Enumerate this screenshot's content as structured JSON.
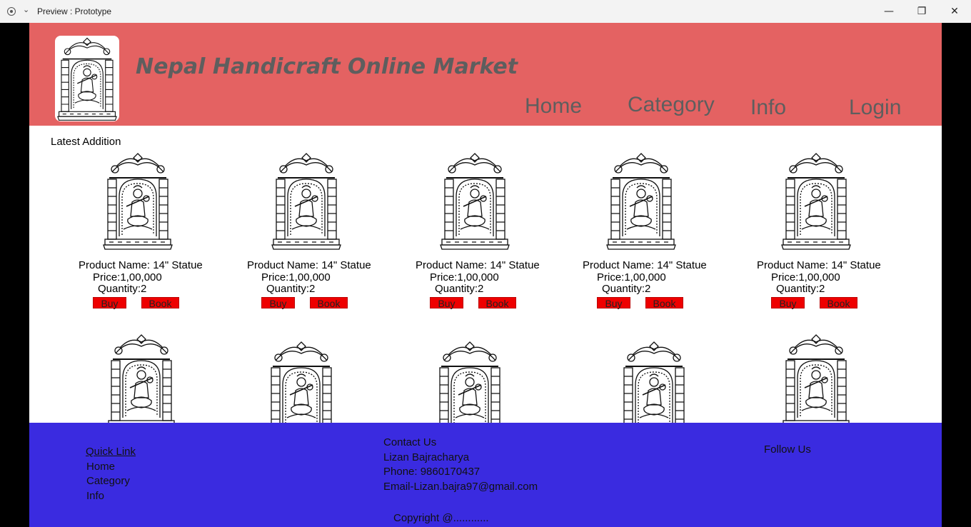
{
  "window": {
    "title": "Preview : Prototype",
    "menu_glyph": "⌄",
    "minimize_glyph": "—",
    "maximize_glyph": "❐",
    "close_glyph": "✕"
  },
  "header": {
    "title": "Nepal Handicraft Online Market",
    "nav": [
      "Home",
      "Category",
      "Info",
      "Login"
    ],
    "logo_icon": "saraswati-statue-icon"
  },
  "main": {
    "section_title": "Latest Addition",
    "products": [
      {
        "name": "Product Name: 14\" Statue",
        "price": "Price:1,00,000",
        "quantity": "Quantity:2",
        "buy": "Buy",
        "book": "Book"
      },
      {
        "name": "Product Name: 14\" Statue",
        "price": "Price:1,00,000",
        "quantity": "Quantity:2",
        "buy": "Buy",
        "book": "Book"
      },
      {
        "name": "Product Name: 14\" Statue",
        "price": "Price:1,00,000",
        "quantity": "Quantity:2",
        "buy": "Buy",
        "book": "Book"
      },
      {
        "name": "Product Name: 14\" Statue",
        "price": "Price:1,00,000",
        "quantity": "Quantity:2",
        "buy": "Buy",
        "book": "Book"
      },
      {
        "name": "Product Name: 14\" Statue",
        "price": "Price:1,00,000",
        "quantity": "Quantity:2",
        "buy": "Buy",
        "book": "Book"
      }
    ]
  },
  "footer": {
    "quick_link": "Quick Link",
    "links": [
      "Home",
      "Category",
      "Info"
    ],
    "contact_title": "Contact Us",
    "contact_name": "Lizan Bajracharya",
    "phone": "Phone: 9860170437",
    "email": "Email-Lizan.bajra97@gmail.com",
    "follow": "Follow Us",
    "copyright": "Copyright @............"
  },
  "colors": {
    "header_bg": "#e46262",
    "footer_bg": "#3a2be0",
    "button_bg": "#ee0000"
  }
}
